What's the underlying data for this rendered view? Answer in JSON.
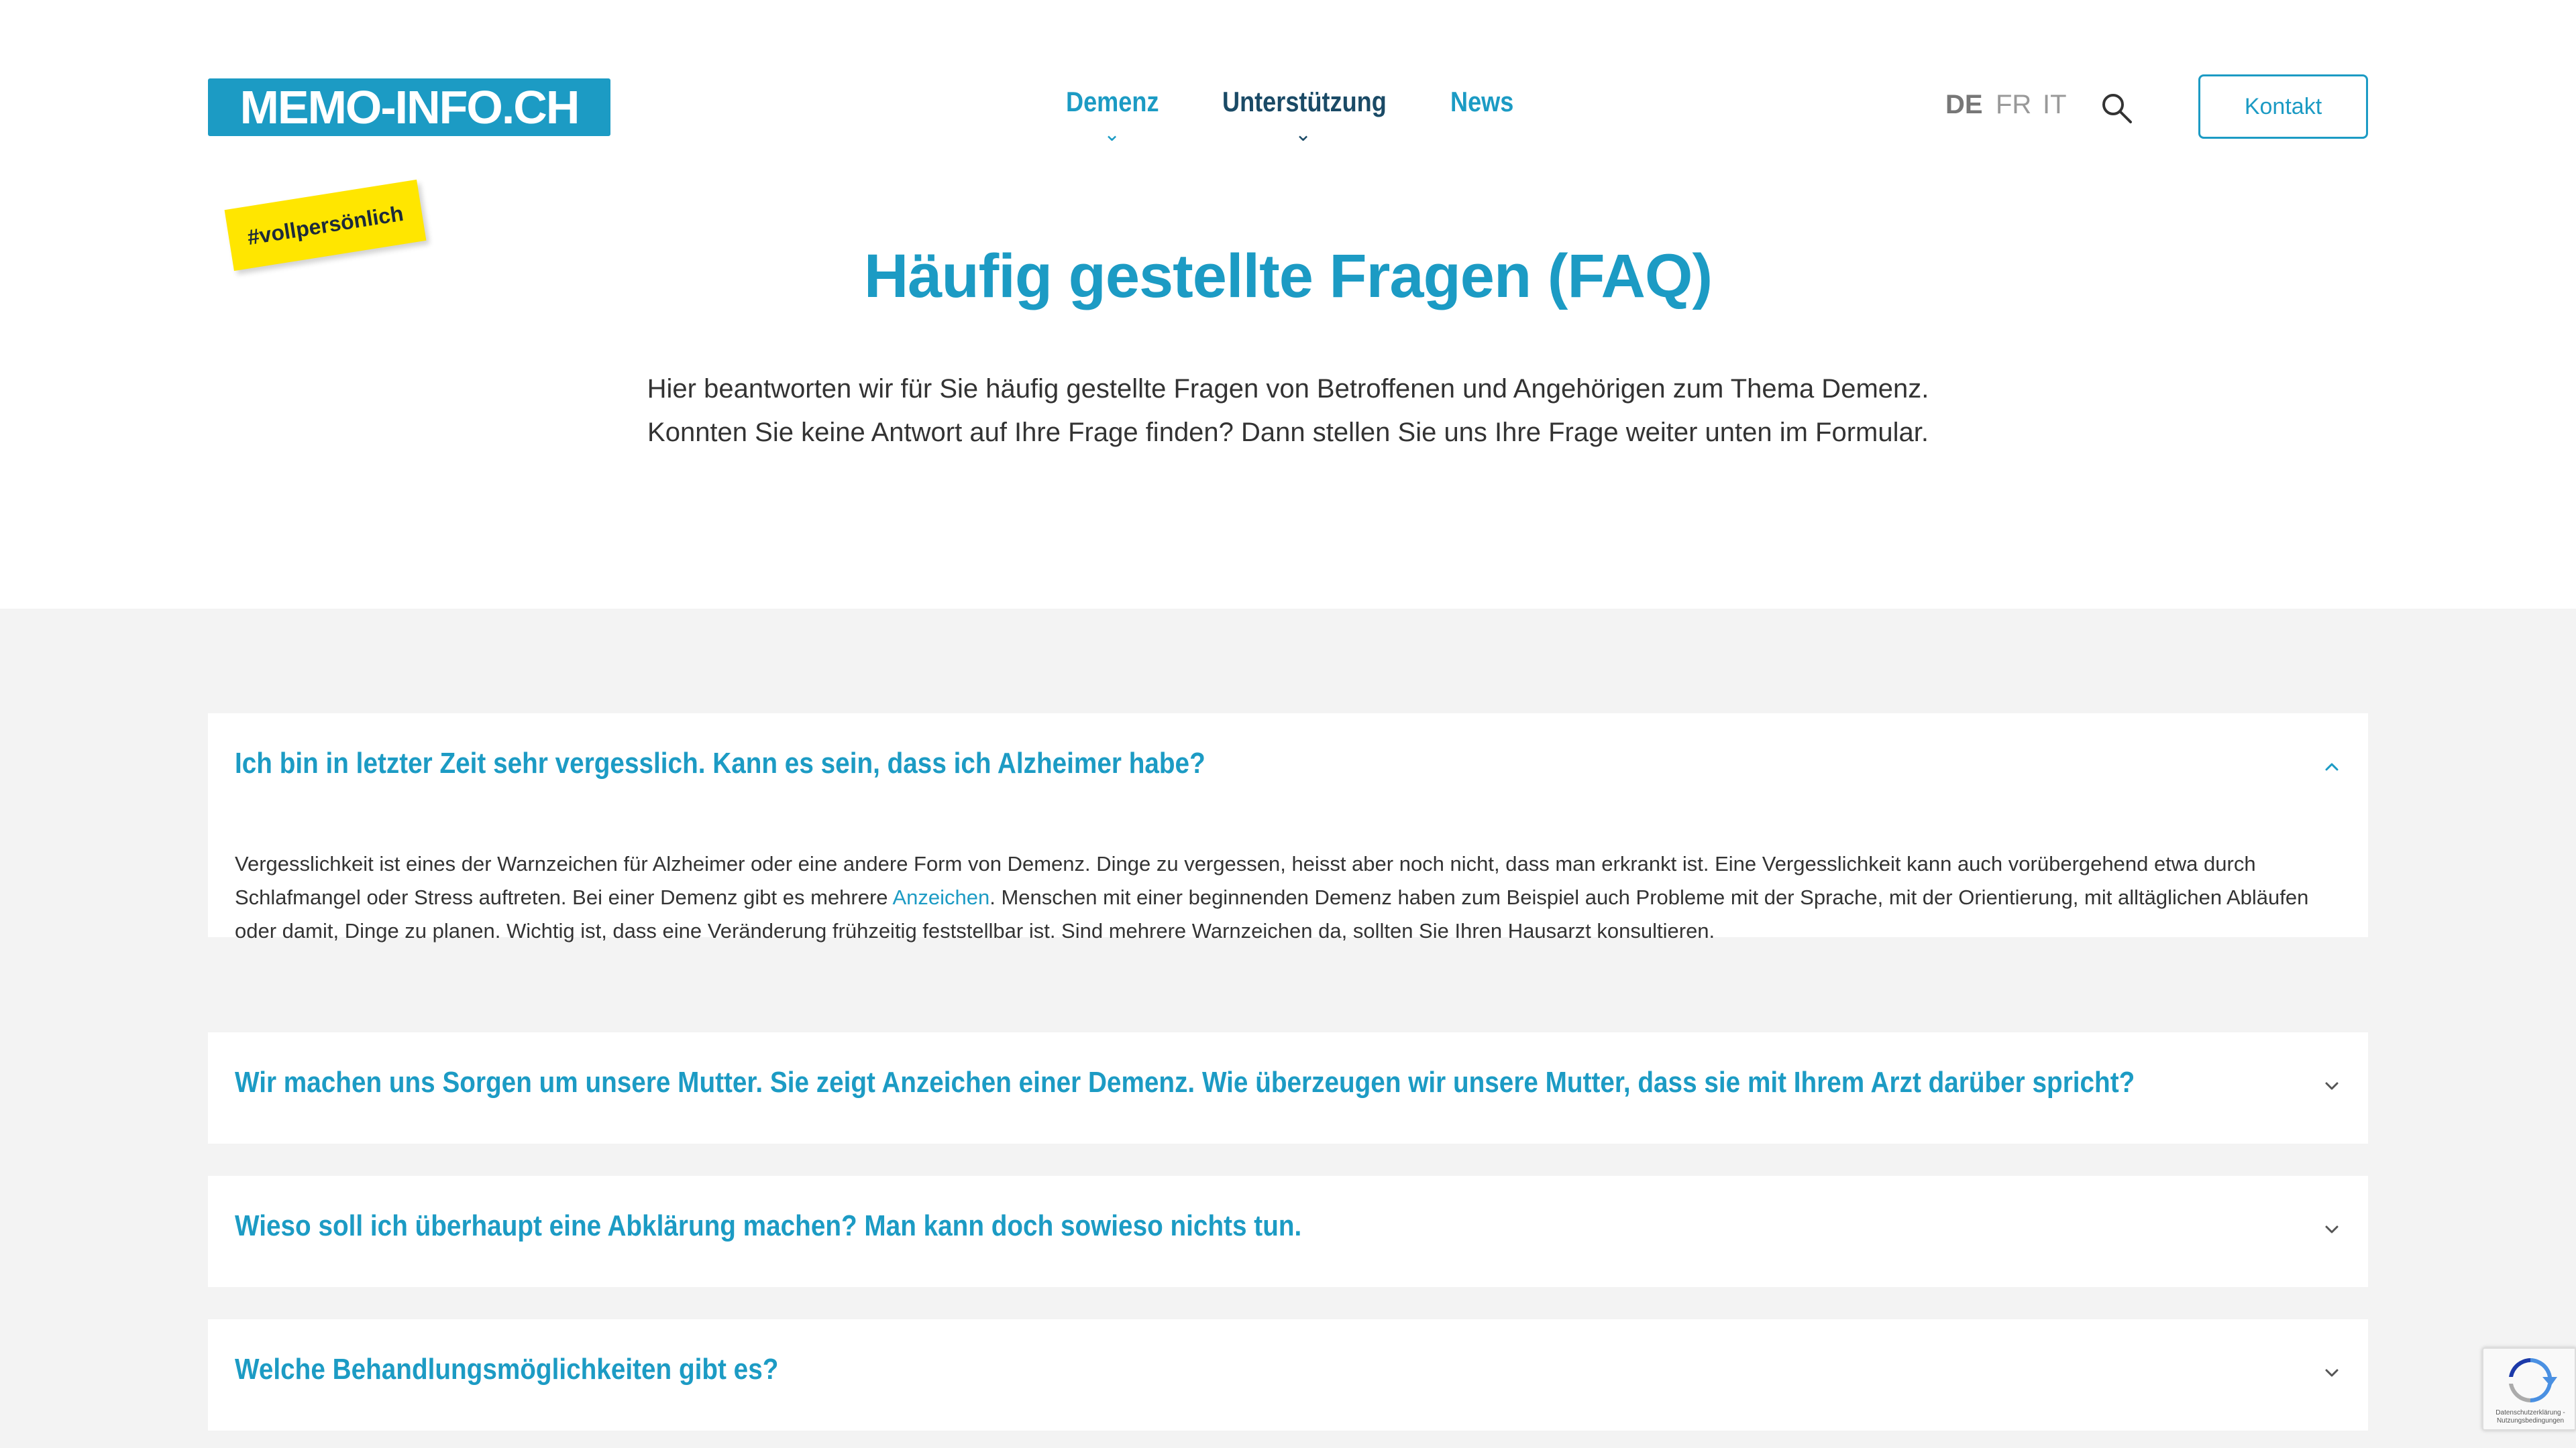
{
  "header": {
    "logo": "MEMO-INFO.CH",
    "nav": [
      {
        "label": "Demenz",
        "has_submenu": true
      },
      {
        "label": "Unterstützung",
        "has_submenu": true
      },
      {
        "label": "News",
        "has_submenu": false
      }
    ],
    "languages": [
      "DE",
      "FR",
      "IT"
    ],
    "active_language": "DE",
    "contact_label": "Kontakt"
  },
  "sticker": "#vollpersönlich",
  "hero": {
    "title": "Häufig gestellte Fragen (FAQ)",
    "intro_line1": "Hier beantworten wir für Sie häufig gestellte Fragen von Betroffenen und Angehörigen zum Thema Demenz.",
    "intro_line2": "Konnten Sie keine Antwort auf Ihre Frage finden? Dann stellen Sie uns Ihre Frage weiter unten im Formular."
  },
  "faq": [
    {
      "question": "Ich bin in letzter Zeit sehr vergesslich. Kann es sein, dass ich Alzheimer habe?",
      "expanded": true,
      "answer_part1": "Vergesslichkeit ist eines der Warnzeichen für Alzheimer oder eine andere Form von Demenz. Dinge zu vergessen, heisst aber noch nicht, dass man erkrankt ist. Eine Vergesslichkeit kann auch vorübergehend etwa durch Schlafmangel oder Stress auftreten. Bei einer Demenz gibt es mehrere ",
      "answer_link": "Anzeichen",
      "answer_part2": ". Menschen mit einer beginnenden Demenz haben zum Beispiel auch Probleme mit der Sprache, mit der Orientierung, mit alltäglichen Abläufen oder damit, Dinge zu planen. Wichtig ist, dass eine Veränderung frühzeitig feststellbar ist. Sind mehrere Warnzeichen da, sollten Sie Ihren Hausarzt konsultieren."
    },
    {
      "question": "Wir machen uns Sorgen um unsere Mutter. Sie zeigt Anzeichen einer Demenz. Wie überzeugen wir unsere Mutter, dass sie mit Ihrem Arzt darüber spricht?",
      "expanded": false
    },
    {
      "question": "Wieso soll ich überhaupt eine Abklärung machen? Man kann doch sowieso nichts tun.",
      "expanded": false
    },
    {
      "question": "Welche Behandlungsmöglichkeiten gibt es?",
      "expanded": false
    }
  ],
  "recaptcha": {
    "text": "Datenschutzerklärung - Nutzungsbedingungen"
  },
  "colors": {
    "brand": "#1c9bc4",
    "nav_dark": "#1a4a66",
    "sticker": "#ffe600",
    "section_bg": "#f3f3f3"
  }
}
